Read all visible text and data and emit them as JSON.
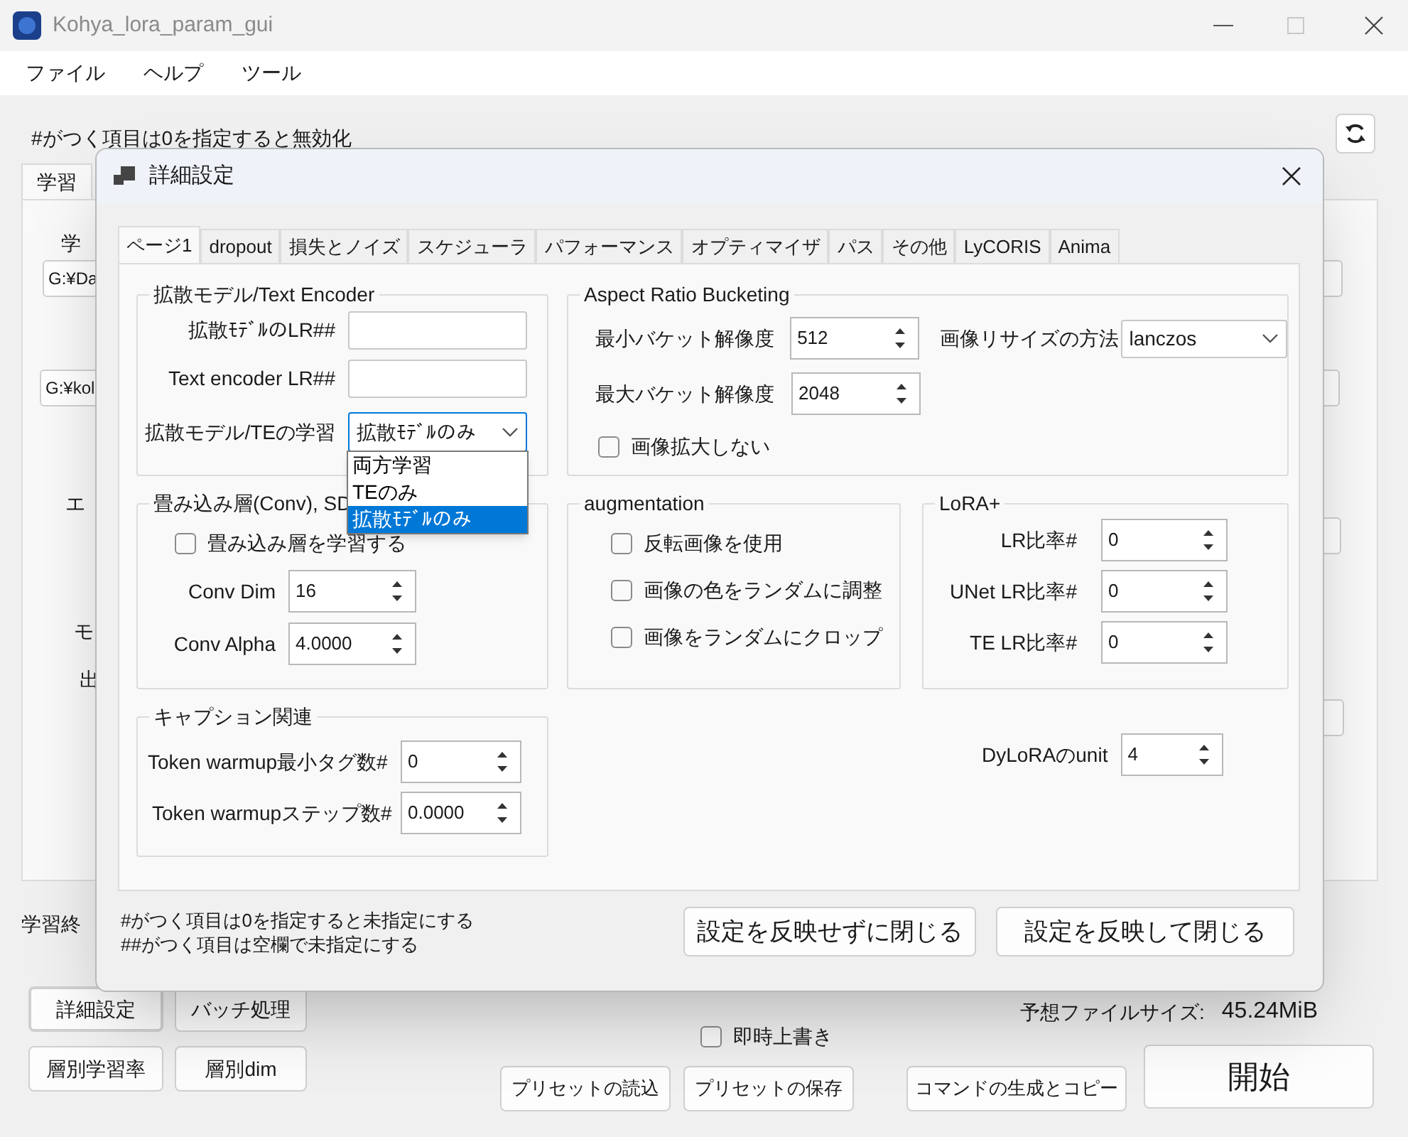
{
  "window": {
    "title": "Kohya_lora_param_gui"
  },
  "menu": [
    {
      "label": "ファイル"
    },
    {
      "label": "ヘルプ"
    },
    {
      "label": "ツール"
    }
  ],
  "main": {
    "notice": "#がつく項目は0を指定すると無効化",
    "tabs": [
      {
        "label": "学習",
        "selected": true
      }
    ],
    "labels": [
      {
        "text": "学"
      },
      {
        "text": "エ"
      },
      {
        "text": "モ"
      },
      {
        "text": "出"
      }
    ],
    "path_fields": [
      {
        "value": "G:¥Da"
      },
      {
        "value": "G:¥kol"
      }
    ],
    "end_label": "学習終",
    "buttons": [
      {
        "label": "詳細設定",
        "focused": true
      },
      {
        "label": "バッチ処理",
        "focused": false
      },
      {
        "label": "層別学習率",
        "focused": false
      },
      {
        "label": "層別dim",
        "focused": false
      }
    ],
    "overwrite": {
      "label": "即時上書き",
      "checked": false
    },
    "file_size": {
      "label": "予想ファイルサイズ:",
      "value": "45.24MiB"
    },
    "preset_buttons": [
      {
        "label": "プリセットの読込"
      },
      {
        "label": "プリセットの保存"
      },
      {
        "label": "コマンドの生成とコピー"
      }
    ],
    "start_button": "開始"
  },
  "dialog": {
    "title": "詳細設定",
    "tabs": [
      {
        "label": "ページ1",
        "selected": true
      },
      {
        "label": "dropout",
        "selected": false
      },
      {
        "label": "損失とノイズ",
        "selected": false
      },
      {
        "label": "スケジューラ",
        "selected": false
      },
      {
        "label": "パフォーマンス",
        "selected": false
      },
      {
        "label": "オプティマイザ",
        "selected": false
      },
      {
        "label": "パス",
        "selected": false
      },
      {
        "label": "その他",
        "selected": false
      },
      {
        "label": "LyCORIS",
        "selected": false
      },
      {
        "label": "Anima",
        "selected": false
      }
    ],
    "model_te": {
      "title": "拡散モデル/Text Encoder",
      "unet_lr": {
        "label": "拡散ﾓﾃﾞﾙのLR##"
      },
      "te_lr": {
        "label": "Text encoder LR##"
      },
      "train_target": {
        "label": "拡散モデル/TEの学習",
        "value": "拡散ﾓﾃﾞﾙのみ",
        "expanded": true,
        "options": [
          {
            "label": "両方学習",
            "selected": false
          },
          {
            "label": "TEのみ",
            "selected": false
          },
          {
            "label": "拡散ﾓﾃﾞﾙのみ",
            "selected": true
          }
        ]
      }
    },
    "bucketing": {
      "title": "Aspect Ratio Bucketing",
      "min": {
        "label": "最小バケット解像度",
        "value": "512"
      },
      "max": {
        "label": "最大バケット解像度",
        "value": "2048"
      },
      "resize": {
        "label": "画像リサイズの方法",
        "value": "lanczos"
      },
      "no_upscale": {
        "label": "画像拡大しない",
        "checked": false
      }
    },
    "conv": {
      "title": "畳み込み層(Conv), SD",
      "train": {
        "label": "畳み込み層を学習する",
        "checked": false
      },
      "dim": {
        "label": "Conv Dim",
        "value": "16"
      },
      "alpha": {
        "label": "Conv Alpha",
        "value": "4.0000"
      }
    },
    "augmentation": {
      "title": "augmentation",
      "options": [
        {
          "label": "反転画像を使用",
          "checked": false
        },
        {
          "label": "画像の色をランダムに調整",
          "checked": false
        },
        {
          "label": "画像をランダムにクロップ",
          "checked": false
        }
      ]
    },
    "lora_plus": {
      "title": "LoRA+",
      "fields": [
        {
          "label": "LR比率#",
          "value": "0"
        },
        {
          "label": "UNet LR比率#",
          "value": "0"
        },
        {
          "label": "TE LR比率#",
          "value": "0"
        }
      ]
    },
    "caption": {
      "title": "キャプション関連",
      "fields": [
        {
          "label": "Token warmup最小タグ数#",
          "value": "0"
        },
        {
          "label": "Token warmupステップ数#",
          "value": "0.0000"
        }
      ]
    },
    "dylora": {
      "label": "DyLoRAのunit",
      "value": "4"
    },
    "notes": [
      "#がつく項目は0を指定すると未指定にする",
      "##がつく項目は空欄で未指定にする"
    ],
    "buttons": [
      {
        "label": "設定を反映せずに閉じる"
      },
      {
        "label": "設定を反映して閉じる"
      }
    ]
  }
}
